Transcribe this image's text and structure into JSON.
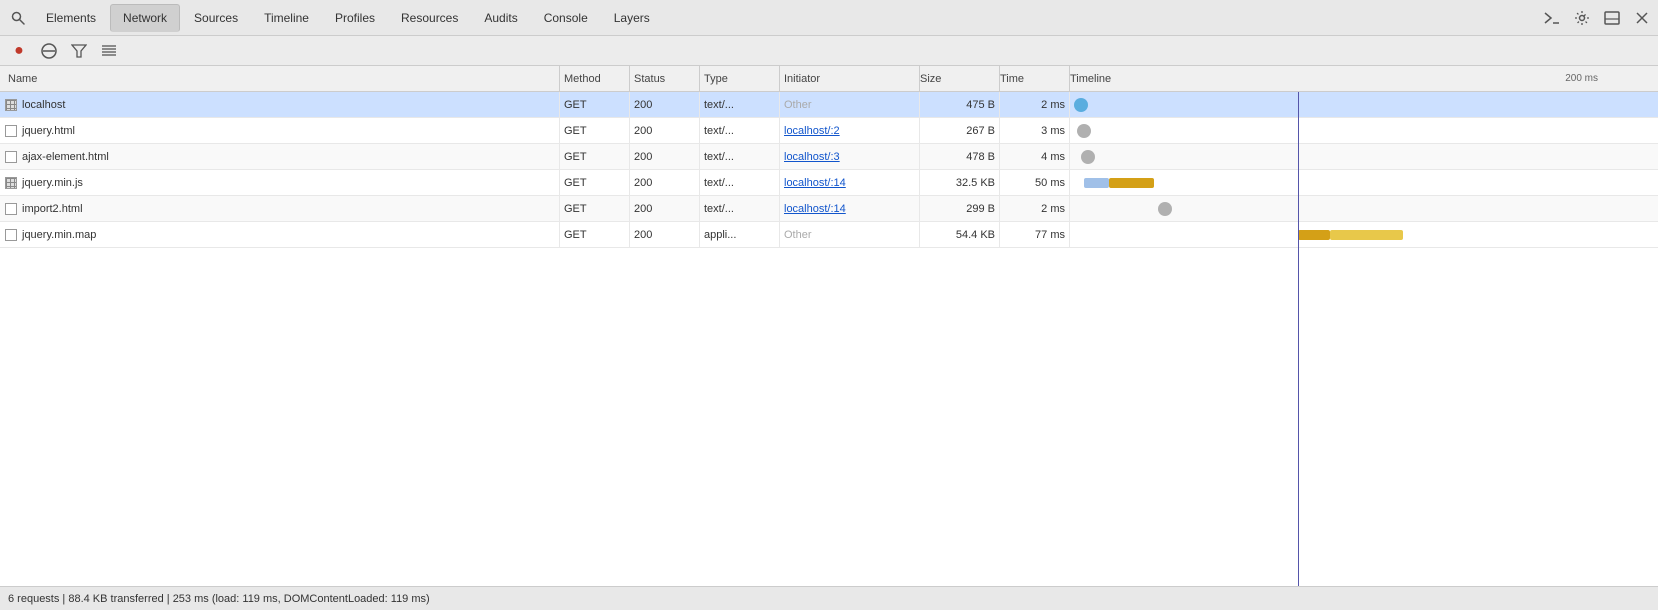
{
  "tabs": [
    {
      "id": "elements",
      "label": "Elements",
      "active": false
    },
    {
      "id": "network",
      "label": "Network",
      "active": true
    },
    {
      "id": "sources",
      "label": "Sources",
      "active": false
    },
    {
      "id": "timeline",
      "label": "Timeline",
      "active": false
    },
    {
      "id": "profiles",
      "label": "Profiles",
      "active": false
    },
    {
      "id": "resources",
      "label": "Resources",
      "active": false
    },
    {
      "id": "audits",
      "label": "Audits",
      "active": false
    },
    {
      "id": "console",
      "label": "Console",
      "active": false
    },
    {
      "id": "layers",
      "label": "Layers",
      "active": false
    }
  ],
  "table": {
    "columns": [
      "Name",
      "Method",
      "Status",
      "Type",
      "Initiator",
      "Size",
      "Time",
      "Timeline"
    ],
    "timeline_ms_label": "200 ms",
    "rows": [
      {
        "name": "localhost",
        "icon": "grid",
        "method": "GET",
        "status": "200",
        "type": "text/...",
        "initiator": "Other",
        "initiator_link": false,
        "size": "475 B",
        "time": "2 ms",
        "bar_type": "circle_blue",
        "bar_left_pct": 1,
        "bar_width_pct": 2,
        "selected": true
      },
      {
        "name": "jquery.html",
        "icon": "plain",
        "method": "GET",
        "status": "200",
        "type": "text/...",
        "initiator": "localhost/:2",
        "initiator_link": true,
        "size": "267 B",
        "time": "3 ms",
        "bar_type": "circle_gray",
        "bar_left_pct": 2,
        "bar_width_pct": 3,
        "selected": false
      },
      {
        "name": "ajax-element.html",
        "icon": "plain",
        "method": "GET",
        "status": "200",
        "type": "text/...",
        "initiator": "localhost/:3",
        "initiator_link": true,
        "size": "478 B",
        "time": "4 ms",
        "bar_type": "circle_gray",
        "bar_left_pct": 3,
        "bar_width_pct": 3,
        "selected": false
      },
      {
        "name": "jquery.min.js",
        "icon": "grid",
        "method": "GET",
        "status": "200",
        "type": "text/...",
        "initiator": "localhost/:14",
        "initiator_link": true,
        "size": "32.5 KB",
        "time": "50 ms",
        "bar_type": "bar_double_yellow",
        "bar_left_pct": 4,
        "bar_width_pct": 20,
        "selected": false
      },
      {
        "name": "import2.html",
        "icon": "plain",
        "method": "GET",
        "status": "200",
        "type": "text/...",
        "initiator": "localhost/:14",
        "initiator_link": true,
        "size": "299 B",
        "time": "2 ms",
        "bar_type": "circle_gray",
        "bar_left_pct": 25,
        "bar_width_pct": 2,
        "selected": false
      },
      {
        "name": "jquery.min.map",
        "icon": "plain",
        "method": "GET",
        "status": "200",
        "type": "appli...",
        "initiator": "Other",
        "initiator_link": false,
        "size": "54.4 KB",
        "time": "77 ms",
        "bar_type": "bar_double_yellow_right",
        "bar_left_pct": 65,
        "bar_width_pct": 30,
        "selected": false
      }
    ]
  },
  "status_bar": {
    "text": "6 requests | 88.4 KB transferred | 253 ms (load: 119 ms, DOMContentLoaded: 119 ms)"
  },
  "toolbar": {
    "record_label": "●",
    "clear_label": "🚫",
    "filter_label": "▽",
    "list_label": "≡"
  }
}
